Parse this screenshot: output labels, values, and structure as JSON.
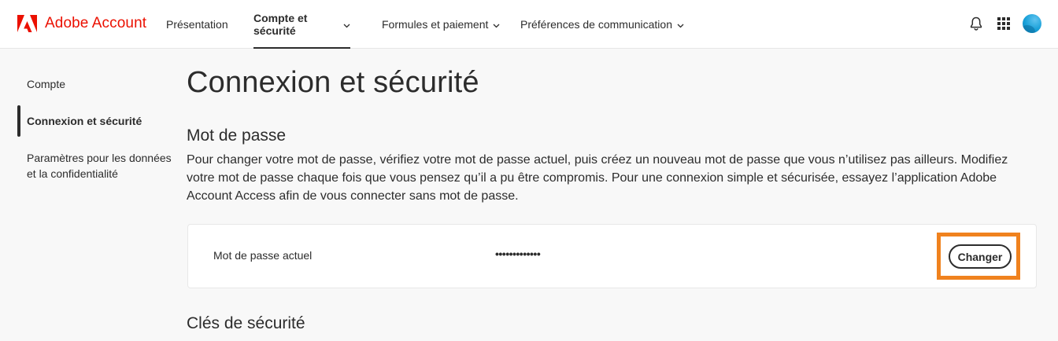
{
  "header": {
    "brand_name": "Adobe Account",
    "brand_color": "#eb1000",
    "nav": [
      {
        "label": "Présentation",
        "has_dropdown": false,
        "active": false
      },
      {
        "label": "Compte et sécurité",
        "has_dropdown": true,
        "active": true
      },
      {
        "label": "Formules et paiement",
        "has_dropdown": true,
        "active": false
      },
      {
        "label": "Préférences de communication",
        "has_dropdown": true,
        "active": false
      }
    ],
    "icons": [
      "bell-icon",
      "apps-grid-icon",
      "avatar"
    ]
  },
  "sidebar": {
    "items": [
      {
        "label": "Compte",
        "active": false
      },
      {
        "label": "Connexion et sécurité",
        "active": true
      },
      {
        "label": "Paramètres pour les données",
        "label_line2": "et la confidentialité",
        "active": false
      }
    ]
  },
  "main": {
    "title": "Connexion et sécurité",
    "password_section": {
      "title": "Mot de passe",
      "description": "Pour changer votre mot de passe, vérifiez votre mot de passe actuel, puis créez un nouveau mot de passe que vous n’utilisez pas ailleurs. Modifiez votre mot de passe chaque fois que vous pensez qu’il a pu être compromis. Pour une connexion simple et sécurisée, essayez l’application Adobe Account Access afin de vous connecter sans mot de passe.",
      "current_label": "Mot de passe actuel",
      "current_value": "•••••••••••••",
      "change_button": "Changer",
      "highlight_color": "#f0821e"
    },
    "security_keys_section": {
      "title": "Clés de sécurité"
    }
  }
}
